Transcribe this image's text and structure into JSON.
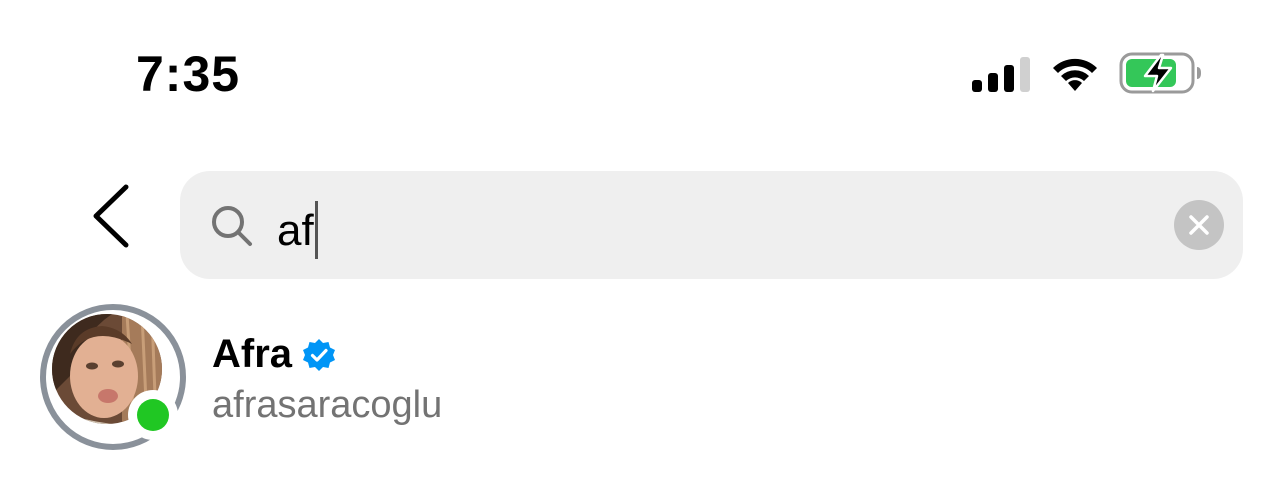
{
  "status_bar": {
    "time": "7:35",
    "signal_icon": "cellular-signal-icon",
    "wifi_icon": "wifi-icon",
    "battery_icon": "battery-charging-icon",
    "battery_color": "#34c759"
  },
  "header": {
    "back_icon": "chevron-left-icon"
  },
  "search": {
    "icon": "search-icon",
    "value": "af",
    "clear_icon": "clear-x-icon",
    "background": "#efefef"
  },
  "results": [
    {
      "display_name": "Afra",
      "username": "afrasaracoglu",
      "verified": true,
      "verified_color": "#0095f6",
      "online": true,
      "online_color": "#20c723",
      "has_story_ring": true
    }
  ]
}
